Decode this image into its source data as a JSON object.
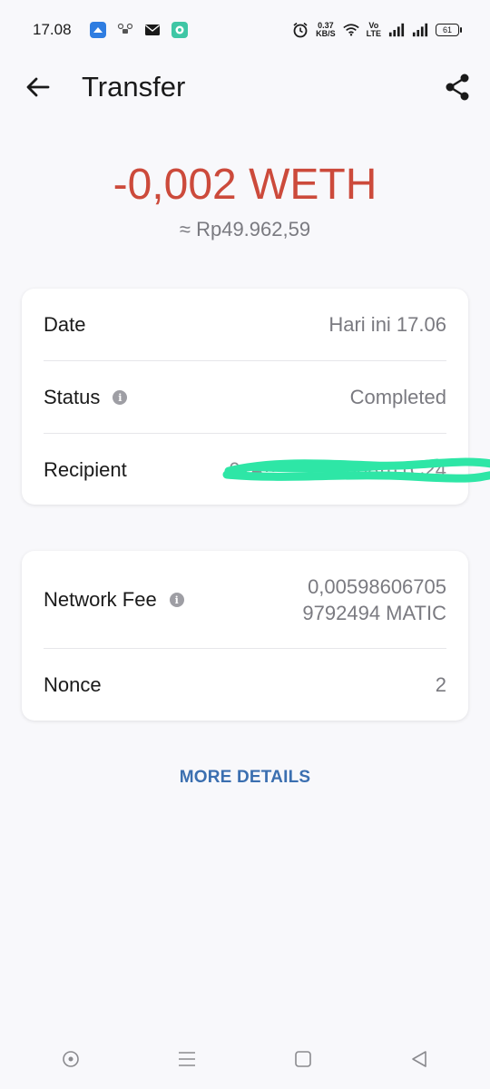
{
  "status_bar": {
    "time": "17.08",
    "net_speed_value": "0.37",
    "net_speed_unit": "KB/S",
    "volte_top": "Vo",
    "volte_bottom": "LTE",
    "battery": "61",
    "icons": [
      "app-icon",
      "drone-icon",
      "mail-icon",
      "chat-icon",
      "alarm-icon",
      "wifi-icon",
      "signal-icon",
      "signal-icon"
    ]
  },
  "app_bar": {
    "title": "Transfer",
    "back_icon": "arrow-left-icon",
    "share_icon": "share-icon"
  },
  "amount": {
    "value": "-0,002 WETH",
    "fiat": "≈ Rp49.962,59",
    "color": "#cc4a3b"
  },
  "details_card": {
    "rows": [
      {
        "label": "Date",
        "value": "Hari ini 17.06"
      },
      {
        "label": "Status",
        "value": "Completed"
      },
      {
        "label": "Recipient",
        "value": "0xA··· ··· ···1b88···1C24"
      }
    ]
  },
  "fee_card": {
    "rows": [
      {
        "label": "Network Fee",
        "value_line1": "0,00598606705",
        "value_line2": "9792494 MATIC"
      },
      {
        "label": "Nonce",
        "value": "2"
      }
    ]
  },
  "more_details_label": "MORE DETAILS",
  "accent_color": "#3b6fb0",
  "nav_bar": {
    "icons": [
      "assistant-icon",
      "menu-icon",
      "home-icon",
      "back-icon"
    ]
  }
}
